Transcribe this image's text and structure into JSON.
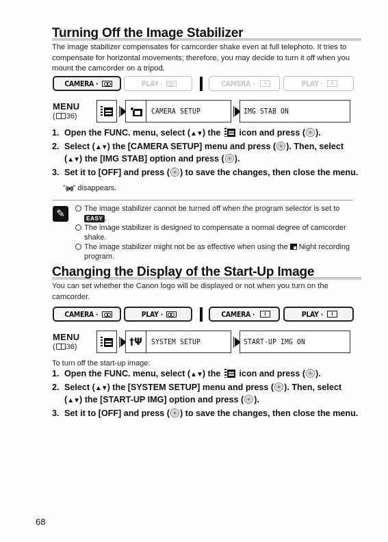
{
  "section1": {
    "title": "Turning Off the Image Stabilizer",
    "intro": "The image stabilizer compensates for camcorder shake even at full telephoto. It tries to compensate for horizontal movements; therefore, you may decide to turn it off when you mount the camcorder on a tripod.",
    "modes": [
      {
        "label": "CAMERA ·",
        "media": "tape-icon",
        "active": true
      },
      {
        "label": "PLAY ·",
        "media": "tape-icon",
        "active": false
      },
      {
        "label": "CAMERA ·",
        "media": "card-icon",
        "active": false
      },
      {
        "label": "PLAY ·",
        "media": "card-icon",
        "active": false
      }
    ],
    "menu": {
      "label": "MENU",
      "ref_open": "(",
      "ref_page": "36)",
      "submenu": "CAMERA SETUP",
      "setting": "IMG STAB ON"
    },
    "steps": [
      {
        "num": "1.",
        "a": "Open the FUNC. menu, select (",
        "b": ") the ",
        "c": " icon and press (",
        "d": ")."
      },
      {
        "num": "2.",
        "a": "Select (",
        "b": ") the [CAMERA SETUP] menu and press (",
        "c": "). Then, select (",
        "d": ") the [IMG STAB] option and press (",
        "e": ")."
      },
      {
        "num": "3.",
        "a": "Set it to [OFF] and press (",
        "b": ") to save the changes, then close the menu."
      }
    ],
    "result_open": "\"",
    "result_glyph": "((■))",
    "result_text": "\" disappears.",
    "notes": [
      {
        "text": "The image stabilizer cannot be turned off when the program selector is set to",
        "badge": "EASY",
        "after": "."
      },
      {
        "text": "The image stabilizer is designed to compensate a normal degree of camcorder shake."
      },
      {
        "text_before": "The image stabilizer might not be as effective when using the",
        "text_after": "Night recording program."
      }
    ]
  },
  "section2": {
    "title": "Changing the Display of the Start-Up Image",
    "intro": "You can set whether the Canon logo will be displayed or not when you turn on the camcorder.",
    "modes": [
      {
        "label": "CAMERA ·",
        "media": "tape-icon",
        "active": true
      },
      {
        "label": "PLAY ·",
        "media": "tape-icon",
        "active": true
      },
      {
        "label": "CAMERA ·",
        "media": "card-icon",
        "active": true
      },
      {
        "label": "PLAY ·",
        "media": "card-icon",
        "active": true
      }
    ],
    "menu": {
      "label": "MENU",
      "ref_open": "(",
      "ref_page": "36)",
      "submenu": "SYSTEM SETUP",
      "setting": "START-UP IMG ON"
    },
    "lead": "To turn off the start-up image:",
    "steps": [
      {
        "num": "1.",
        "a": "Open the FUNC. menu, select (",
        "b": ") the ",
        "c": " icon and press (",
        "d": ")."
      },
      {
        "num": "2.",
        "a": "Select (",
        "b": ") the [SYSTEM SETUP] menu and press (",
        "c": "). Then, select (",
        "d": ") the [START-UP IMG] option and press (",
        "e": ")."
      },
      {
        "num": "3.",
        "a": "Set it to [OFF] and press (",
        "b": ") to save the changes, then close the menu."
      }
    ]
  },
  "glyphs": {
    "up_down": "▲▼",
    "tools": "†Ψ"
  },
  "page_number": "68"
}
